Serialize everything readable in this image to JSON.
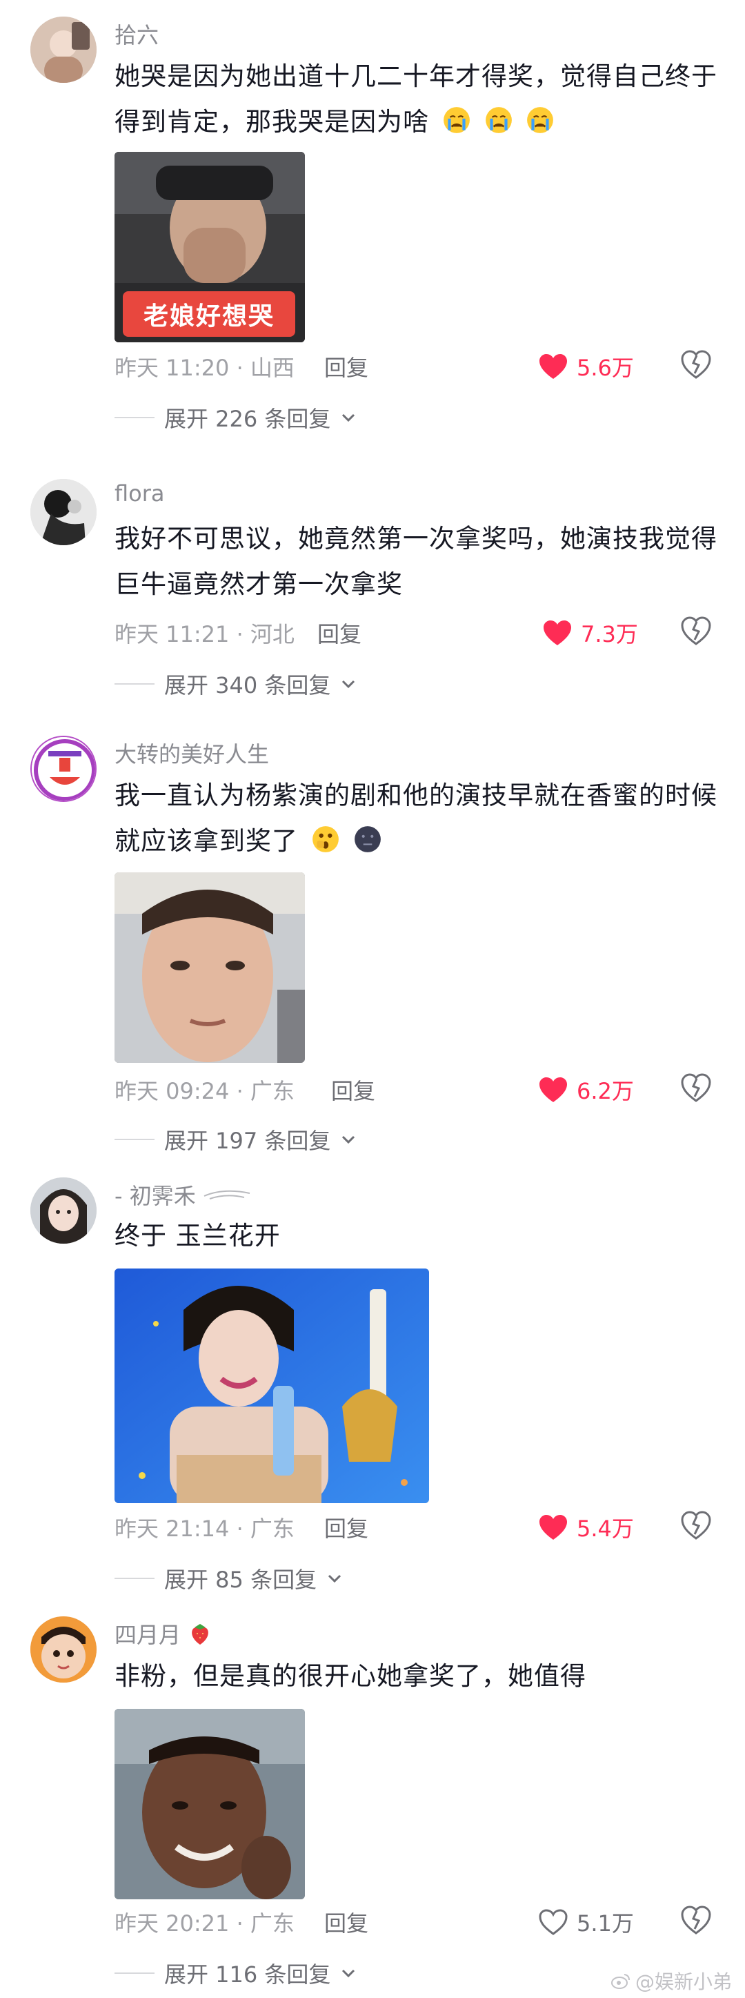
{
  "comments": [
    {
      "username": "拾六",
      "text": "她哭是因为她出道十几二十年才得奖，觉得自己终于得到肯定，那我哭是因为啥",
      "emojis": [
        "crying-emoji",
        "crying-emoji",
        "crying-emoji"
      ],
      "image_caption": "老娘好想哭",
      "time_location": "昨天 11:20 · 山西",
      "reply_label": "回复",
      "likes": "5.6万",
      "liked": true,
      "expand_label": "展开 226 条回复"
    },
    {
      "username": "flora",
      "text": "我好不可思议，她竟然第一次拿奖吗，她演技我觉得巨牛逼竟然才第一次拿奖",
      "time_location": "昨天 11:21 · 河北",
      "reply_label": "回复",
      "likes": "7.3万",
      "liked": true,
      "expand_label": "展开 340 条回复"
    },
    {
      "username": "大转的美好人生",
      "text": "我一直认为杨紫演的剧和他的演技早就在香蜜的时候就应该拿到奖了",
      "emojis": [
        "shocked-emoji",
        "dark-face-emoji"
      ],
      "time_location": "昨天 09:24 · 广东",
      "reply_label": "回复",
      "likes": "6.2万",
      "liked": true,
      "expand_label": "展开 197 条回复"
    },
    {
      "username": "- 初霁禾",
      "text": "终于 玉兰花开",
      "time_location": "昨天 21:14 · 广东",
      "reply_label": "回复",
      "likes": "5.4万",
      "liked": true,
      "expand_label": "展开 85 条回复"
    },
    {
      "username": "四月月",
      "text": "非粉，但是真的很开心她拿奖了，她值得",
      "time_location": "昨天 20:21 · 广东",
      "reply_label": "回复",
      "likes": "5.1万",
      "liked": false,
      "expand_label": "展开 116 条回复"
    }
  ],
  "watermark": "@娱新小弟",
  "colors": {
    "like_red": "#fe2c55",
    "meta_gray": "#a0a1a6",
    "text_dark": "#161823"
  }
}
